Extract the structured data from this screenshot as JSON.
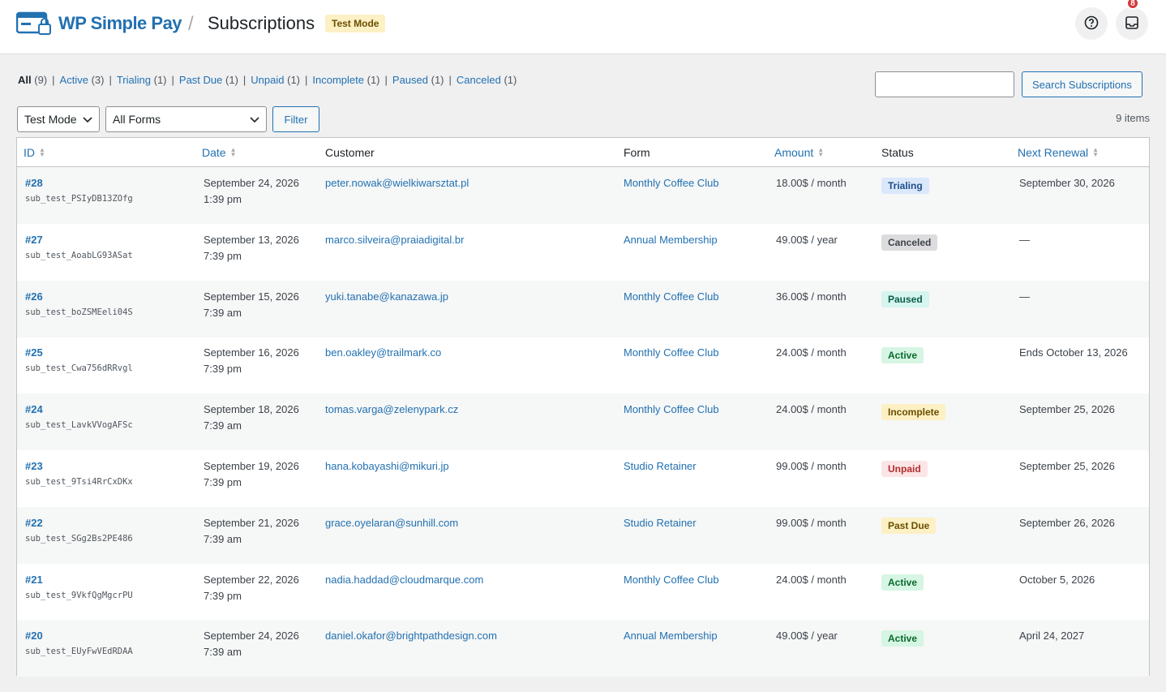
{
  "header": {
    "brand": "WP Simple Pay",
    "separator": "/",
    "title": "Subscriptions",
    "mode_badge": "Test Mode",
    "notification_count": "8"
  },
  "views": [
    {
      "label": "All",
      "count": "(9)",
      "current": true
    },
    {
      "label": "Active",
      "count": "(3)"
    },
    {
      "label": "Trialing",
      "count": "(1)"
    },
    {
      "label": "Past Due",
      "count": "(1)"
    },
    {
      "label": "Unpaid",
      "count": "(1)"
    },
    {
      "label": "Incomplete",
      "count": "(1)"
    },
    {
      "label": "Paused",
      "count": "(1)"
    },
    {
      "label": "Canceled",
      "count": "(1)"
    }
  ],
  "search": {
    "button": "Search Subscriptions",
    "value": ""
  },
  "filters": {
    "mode": "Test Mode",
    "forms": "All Forms",
    "button": "Filter"
  },
  "items_count": "9 items",
  "columns": {
    "id": "ID",
    "date": "Date",
    "customer": "Customer",
    "form": "Form",
    "amount": "Amount",
    "status": "Status",
    "renewal": "Next Renewal"
  },
  "status_colors": {
    "Trialing": {
      "bg": "#dbe8fb",
      "fg": "#1d4e89"
    },
    "Canceled": {
      "bg": "#dcdcde",
      "fg": "#3c434a"
    },
    "Paused": {
      "bg": "#d5f5ee",
      "fg": "#0a5c4c"
    },
    "Active": {
      "bg": "#d6f5e3",
      "fg": "#0a6b2c"
    },
    "Incomplete": {
      "bg": "#fcf0c4",
      "fg": "#6b4f00"
    },
    "Unpaid": {
      "bg": "#fbe5e6",
      "fg": "#b32d2e"
    },
    "Past Due": {
      "bg": "#fcf0c4",
      "fg": "#6b4f00"
    }
  },
  "rows": [
    {
      "id": "#28",
      "sub": "sub_test_PSIyDB13ZOfg",
      "date": "September 24, 2026",
      "time": "1:39 pm",
      "customer": "peter.nowak@wielkiwarsztat.pl",
      "form": "Monthly Coffee Club",
      "amount": "18.00$ / month",
      "status": "Trialing",
      "renewal": "September 30, 2026"
    },
    {
      "id": "#27",
      "sub": "sub_test_AoabLG93ASat",
      "date": "September 13, 2026",
      "time": "7:39 pm",
      "customer": "marco.silveira@praiadigital.br",
      "form": "Annual Membership",
      "amount": "49.00$ / year",
      "status": "Canceled",
      "renewal": "—"
    },
    {
      "id": "#26",
      "sub": "sub_test_boZSMEeli04S",
      "date": "September 15, 2026",
      "time": "7:39 am",
      "customer": "yuki.tanabe@kanazawa.jp",
      "form": "Monthly Coffee Club",
      "amount": "36.00$ / month",
      "status": "Paused",
      "renewal": "—"
    },
    {
      "id": "#25",
      "sub": "sub_test_Cwa756dRRvgl",
      "date": "September 16, 2026",
      "time": "7:39 pm",
      "customer": "ben.oakley@trailmark.co",
      "form": "Monthly Coffee Club",
      "amount": "24.00$ / month",
      "status": "Active",
      "renewal": "Ends October 13, 2026"
    },
    {
      "id": "#24",
      "sub": "sub_test_LavkVVogAFSc",
      "date": "September 18, 2026",
      "time": "7:39 am",
      "customer": "tomas.varga@zelenypark.cz",
      "form": "Monthly Coffee Club",
      "amount": "24.00$ / month",
      "status": "Incomplete",
      "renewal": "September 25, 2026"
    },
    {
      "id": "#23",
      "sub": "sub_test_9Tsi4RrCxDKx",
      "date": "September 19, 2026",
      "time": "7:39 pm",
      "customer": "hana.kobayashi@mikuri.jp",
      "form": "Studio Retainer",
      "amount": "99.00$ / month",
      "status": "Unpaid",
      "renewal": "September 25, 2026"
    },
    {
      "id": "#22",
      "sub": "sub_test_SGg2Bs2PE486",
      "date": "September 21, 2026",
      "time": "7:39 am",
      "customer": "grace.oyelaran@sunhill.com",
      "form": "Studio Retainer",
      "amount": "99.00$ / month",
      "status": "Past Due",
      "renewal": "September 26, 2026"
    },
    {
      "id": "#21",
      "sub": "sub_test_9VkfQgMgcrPU",
      "date": "September 22, 2026",
      "time": "7:39 pm",
      "customer": "nadia.haddad@cloudmarque.com",
      "form": "Monthly Coffee Club",
      "amount": "24.00$ / month",
      "status": "Active",
      "renewal": "October 5, 2026"
    },
    {
      "id": "#20",
      "sub": "sub_test_EUyFwVEdRDAA",
      "date": "September 24, 2026",
      "time": "7:39 am",
      "customer": "daniel.okafor@brightpathdesign.com",
      "form": "Annual Membership",
      "amount": "49.00$ / year",
      "status": "Active",
      "renewal": "April 24, 2027"
    }
  ]
}
